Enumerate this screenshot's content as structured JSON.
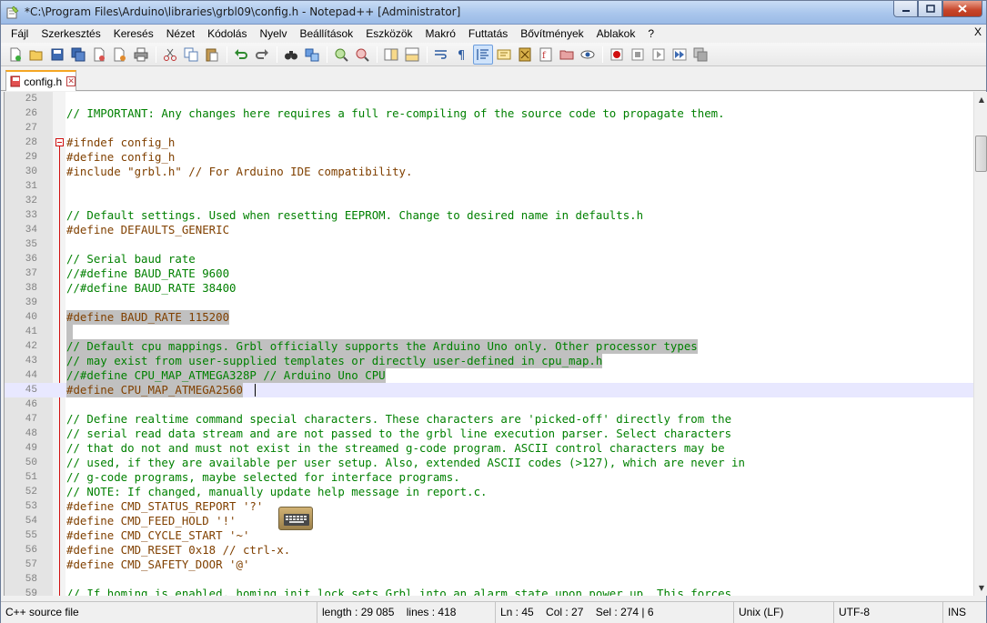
{
  "window": {
    "title": "*C:\\Program Files\\Arduino\\libraries\\grbl09\\config.h - Notepad++ [Administrator]",
    "close_label": "X"
  },
  "menu": [
    "Fájl",
    "Szerkesztés",
    "Keresés",
    "Nézet",
    "Kódolás",
    "Nyelv",
    "Beállítások",
    "Eszközök",
    "Makró",
    "Futtatás",
    "Bővítmények",
    "Ablakok",
    "?"
  ],
  "tab": {
    "label": "config.h"
  },
  "editor": {
    "current_line": 45,
    "lines": [
      {
        "n": "25",
        "text": "",
        "kind": "plain"
      },
      {
        "n": "26",
        "text": "// IMPORTANT: Any changes here requires a full re-compiling of the source code to propagate them.",
        "kind": "comment"
      },
      {
        "n": "27",
        "text": "",
        "kind": "plain"
      },
      {
        "n": "28",
        "text": "#ifndef config_h",
        "kind": "pre"
      },
      {
        "n": "29",
        "text": "#define config_h",
        "kind": "pre"
      },
      {
        "n": "30",
        "text": "#include \"grbl.h\" // For Arduino IDE compatibility.",
        "kind": "pre"
      },
      {
        "n": "31",
        "text": "",
        "kind": "plain"
      },
      {
        "n": "32",
        "text": "",
        "kind": "plain"
      },
      {
        "n": "33",
        "text": "// Default settings. Used when resetting EEPROM. Change to desired name in defaults.h",
        "kind": "comment"
      },
      {
        "n": "34",
        "text": "#define DEFAULTS_GENERIC",
        "kind": "pre"
      },
      {
        "n": "35",
        "text": "",
        "kind": "plain"
      },
      {
        "n": "36",
        "text": "// Serial baud rate",
        "kind": "comment"
      },
      {
        "n": "37",
        "text": "//#define BAUD_RATE 9600",
        "kind": "comment"
      },
      {
        "n": "38",
        "text": "//#define BAUD_RATE 38400",
        "kind": "comment"
      },
      {
        "n": "39",
        "text": "",
        "kind": "plain"
      },
      {
        "n": "40",
        "text": "#define BAUD_RATE 115200",
        "kind": "pre",
        "sel": true
      },
      {
        "n": "41",
        "text": " ",
        "kind": "plain",
        "sel": true
      },
      {
        "n": "42",
        "text": "// Default cpu mappings. Grbl officially supports the Arduino Uno only. Other processor types",
        "kind": "comment",
        "sel": true
      },
      {
        "n": "43",
        "text": "// may exist from user-supplied templates or directly user-defined in cpu_map.h",
        "kind": "comment",
        "sel": true
      },
      {
        "n": "44",
        "text": "//#define CPU_MAP_ATMEGA328P // Arduino Uno CPU",
        "kind": "comment",
        "sel": true
      },
      {
        "n": "45",
        "text": "#define CPU_MAP_ATMEGA2560",
        "kind": "pre",
        "sel": true
      },
      {
        "n": "46",
        "text": "",
        "kind": "plain"
      },
      {
        "n": "47",
        "text": "// Define realtime command special characters. These characters are 'picked-off' directly from the",
        "kind": "comment"
      },
      {
        "n": "48",
        "text": "// serial read data stream and are not passed to the grbl line execution parser. Select characters",
        "kind": "comment"
      },
      {
        "n": "49",
        "text": "// that do not and must not exist in the streamed g-code program. ASCII control characters may be",
        "kind": "comment"
      },
      {
        "n": "50",
        "text": "// used, if they are available per user setup. Also, extended ASCII codes (>127), which are never in",
        "kind": "comment"
      },
      {
        "n": "51",
        "text": "// g-code programs, maybe selected for interface programs.",
        "kind": "comment"
      },
      {
        "n": "52",
        "text": "// NOTE: If changed, manually update help message in report.c.",
        "kind": "comment"
      },
      {
        "n": "53",
        "text": "#define CMD_STATUS_REPORT '?'",
        "kind": "pre"
      },
      {
        "n": "54",
        "text": "#define CMD_FEED_HOLD '!'",
        "kind": "pre"
      },
      {
        "n": "55",
        "text": "#define CMD_CYCLE_START '~'",
        "kind": "pre"
      },
      {
        "n": "56",
        "text": "#define CMD_RESET 0x18 // ctrl-x.",
        "kind": "pre"
      },
      {
        "n": "57",
        "text": "#define CMD_SAFETY_DOOR '@'",
        "kind": "pre"
      },
      {
        "n": "58",
        "text": "",
        "kind": "plain"
      },
      {
        "n": "59",
        "text": "// If homing is enabled, homing init lock sets Grbl into an alarm state upon power up. This forces",
        "kind": "comment"
      }
    ]
  },
  "status": {
    "filetype": "C++ source file",
    "length": "length : 29 085    lines : 418",
    "position": "Ln : 45    Col : 27    Sel : 274 | 6",
    "eol": "Unix (LF)",
    "encoding": "UTF-8",
    "mode": "INS"
  },
  "colors": {
    "comment": "#008000",
    "preprocessor": "#804000",
    "selection": "#c0c0c0",
    "current_line": "#e8e8ff"
  }
}
